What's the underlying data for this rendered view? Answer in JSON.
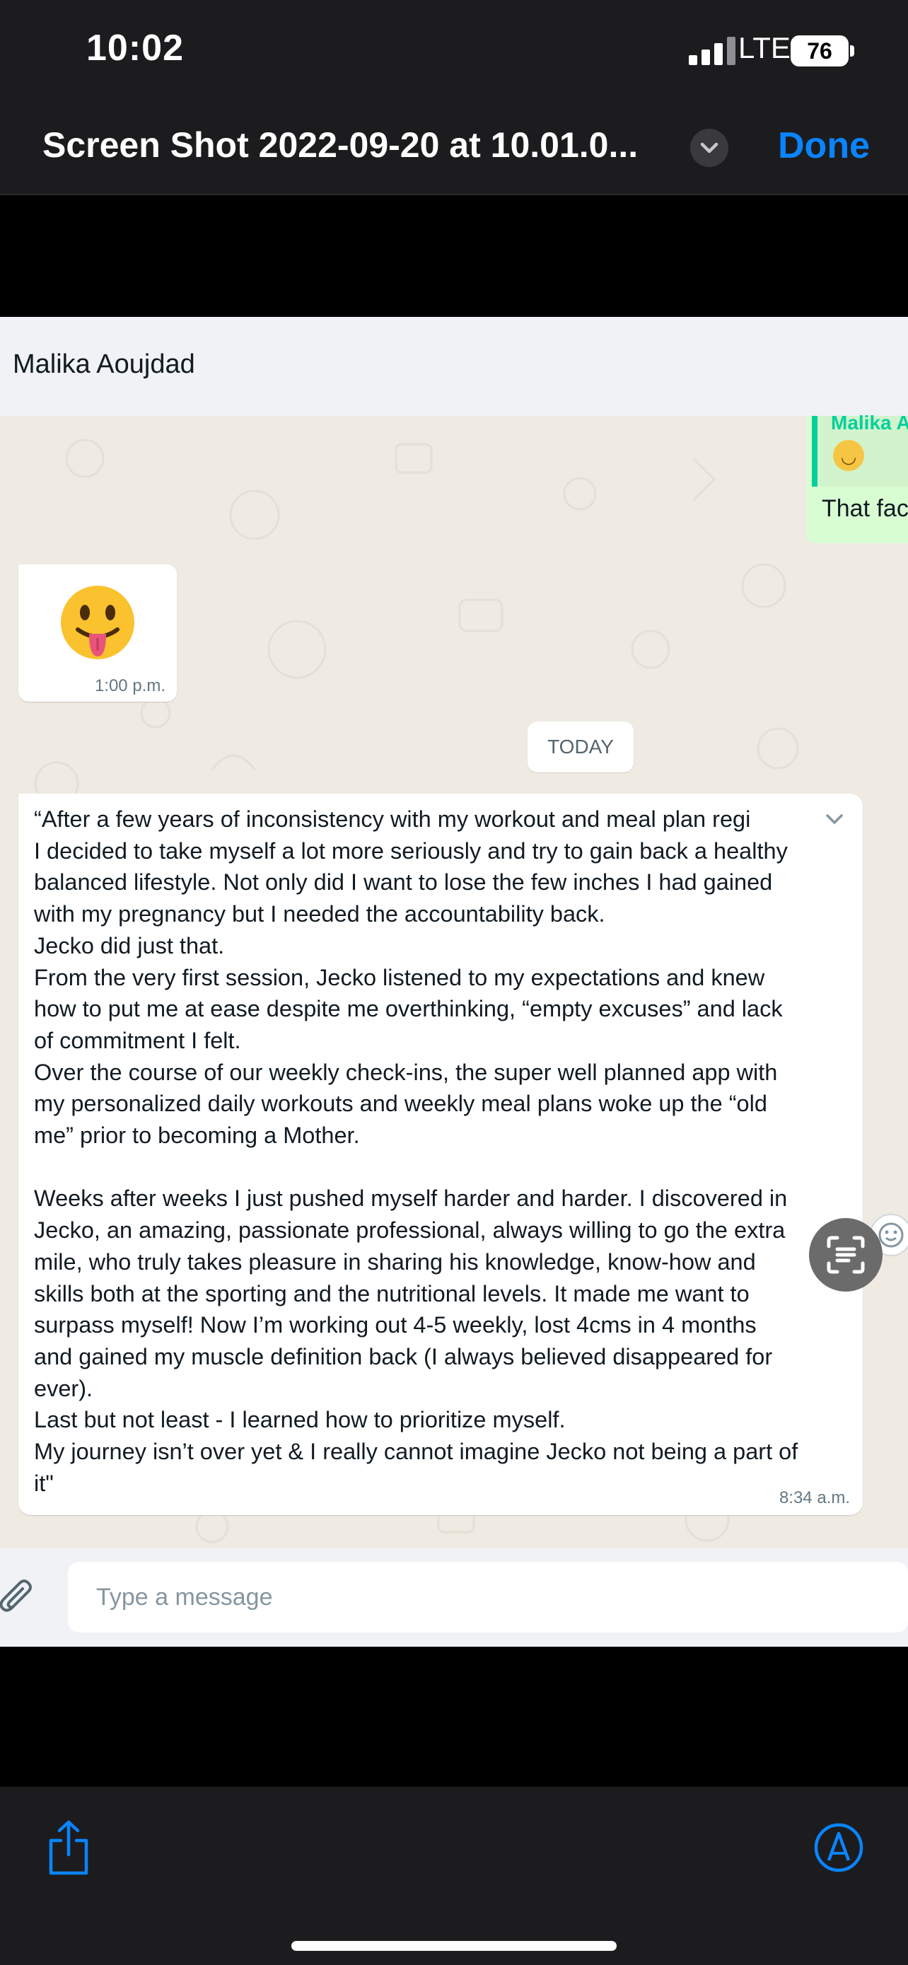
{
  "status_bar": {
    "time": "10:02",
    "network": "LTE",
    "battery": "76"
  },
  "quicklook": {
    "title": "Screen Shot 2022-09-20 at 10.01.0...",
    "done_label": "Done",
    "accent_color": "#0a84ff"
  },
  "whatsapp": {
    "contact_name": "Malika Aoujdad",
    "reply_preview": {
      "quoted_name": "Malika A",
      "quoted_content_icon": "upside-down-face-emoji",
      "text": "That fac"
    },
    "emoji_message": {
      "emoji_icon": "face-with-tongue-emoji",
      "time": "1:00 p.m."
    },
    "date_divider": "TODAY",
    "message": {
      "text": "“After a few years of inconsistency with my workout and meal plan regi\nI decided to take myself a lot more seriously and try to gain back a healthy\nbalanced lifestyle. Not only did I want to lose the few inches I had gained\nwith my pregnancy but I needed the accountability back.\nJecko did just that.\nFrom the very first session, Jecko listened to my expectations and knew\nhow to put me at ease despite me overthinking, “empty excuses” and lack\nof commitment I felt.\nOver the course of our weekly check-ins, the super well planned app with\nmy personalized daily workouts and weekly meal plans woke up the “old\nme” prior to becoming a Mother.\n\nWeeks after weeks I just pushed myself harder and harder. I discovered in\nJecko, an amazing, passionate professional, always willing to go the extra\nmile, who truly takes pleasure in sharing his knowledge, know-how and\nskills both at the sporting and the nutritional levels. It made me want to\nsurpass myself! Now I’m working out 4-5 weekly, lost 4cms in 4 months\nand gained my muscle definition back (I always believed disappeared for\never).\nLast but not least - I learned how to prioritize myself.\nMy journey isn’t over yet & I really cannot imagine Jecko not being a part of\nit\"",
      "time": "8:34 a.m."
    },
    "compose": {
      "placeholder": "Type a message"
    },
    "colors": {
      "chat_bg": "#efeae2",
      "outgoing": "#d9fdd3",
      "quote_accent": "#06cf9c"
    }
  },
  "toolbar": {
    "share_icon": "share-icon",
    "markup_icon": "markup-pen-icon"
  }
}
